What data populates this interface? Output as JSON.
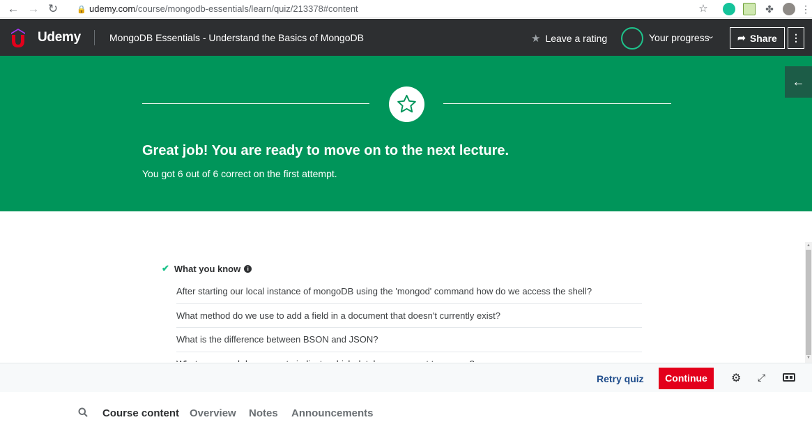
{
  "browser": {
    "url_domain": "udemy.com",
    "url_path": "/course/mongodb-essentials/learn/quiz/213378#content"
  },
  "header": {
    "logo_text": "Udemy",
    "course_title": "MongoDB Essentials - Understand the Basics of MongoDB",
    "leave_rating": "Leave a rating",
    "your_progress": "Your progress",
    "share": "Share"
  },
  "result": {
    "title": "Great job! You are ready to move on to the next lecture.",
    "subtitle": "You got 6 out of 6 correct on the first attempt."
  },
  "what_you_know": {
    "heading": "What you know",
    "questions": [
      "After starting our local instance of mongoDB using the 'mongod' command how do we access the shell?",
      "What method do we use to add a field in a document that doesn't currently exist?",
      "What is the difference between BSON and JSON?",
      "What command do we use to indicate which database we want to access?"
    ]
  },
  "controls": {
    "retry_quiz": "Retry quiz",
    "continue": "Continue"
  },
  "tabs": [
    "Course content",
    "Overview",
    "Notes",
    "Announcements"
  ],
  "colors": {
    "hero_green": "#00955a",
    "topbar": "#2d2f31",
    "continue_red": "#e3001b",
    "retry_blue": "#1f4d8c"
  }
}
